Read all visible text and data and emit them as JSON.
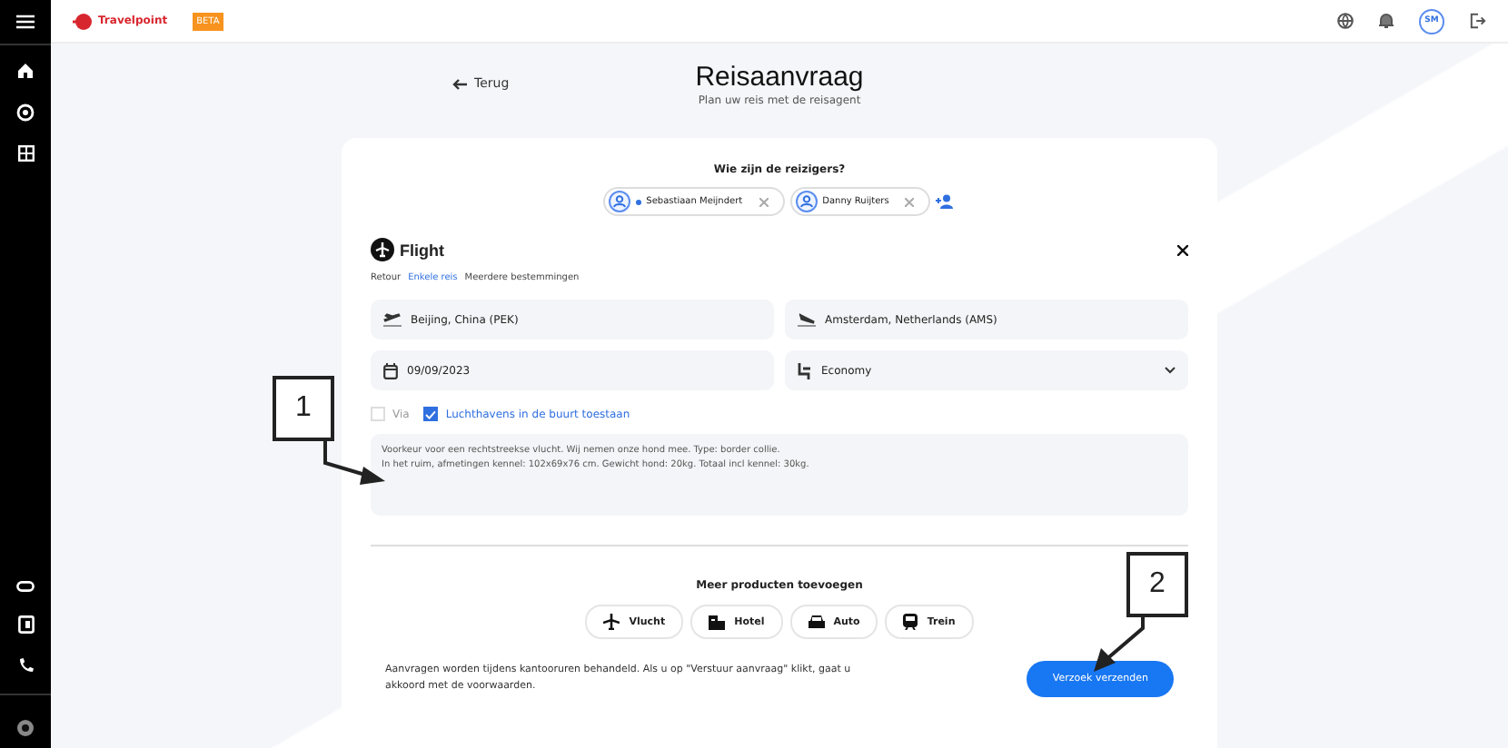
{
  "topbar": {
    "logo": "Travelpoint",
    "badge": "BETA",
    "avatar": "SM"
  },
  "sidebar": {
    "top_items": [
      {
        "kind": "home"
      },
      {
        "kind": "compass"
      },
      {
        "kind": "grid"
      }
    ],
    "bottom_items": [
      {
        "kind": "link"
      },
      {
        "kind": "book"
      },
      {
        "kind": "phone"
      }
    ]
  },
  "back_link": "Terug",
  "title": "Reisaanvraag",
  "subtitle": "Plan uw reis met de reisagent",
  "travelers": {
    "heading": "Wie zijn de reizigers?",
    "chips": [
      {
        "name": "Sebastiaan Meijndert",
        "primary": true
      },
      {
        "name": "Danny Ruijters",
        "primary": false
      }
    ]
  },
  "flight": {
    "title": "Flight",
    "trip_types": [
      {
        "label": "Retour",
        "selected": false
      },
      {
        "label": "Enkele reis",
        "selected": true
      },
      {
        "label": "Meerdere bestemmingen",
        "selected": false
      }
    ],
    "from": "Beijing, China (PEK)",
    "to": "Amsterdam, Netherlands (AMS)",
    "date": "09/09/2023",
    "cabin": "Economy",
    "options": [
      {
        "label": "Via",
        "checked": false
      },
      {
        "label": "Luchthavens in de buurt toestaan",
        "checked": true
      }
    ],
    "notes": [
      "Voorkeur voor een rechtstreekse vlucht. Wij nemen onze hond mee. Type: border collie.",
      "In het ruim, afmetingen kennel: 102x69x76 cm. Gewicht hond: 20kg. Totaal incl kennel: 30kg."
    ]
  },
  "more_products": {
    "heading": "Meer producten toevoegen",
    "items": [
      {
        "kind": "plane",
        "label": "Vlucht"
      },
      {
        "kind": "hotel",
        "label": "Hotel"
      },
      {
        "kind": "car",
        "label": "Auto"
      },
      {
        "kind": "train",
        "label": "Trein"
      }
    ]
  },
  "footer_note": "Aanvragen worden tijdens kantooruren behandeld. Als u op \"Verstuur aanvraag\" klikt, gaat u akkoord met de voorwaarden.",
  "submit": "Verzoek verzenden",
  "annotations": [
    "1",
    "2"
  ]
}
